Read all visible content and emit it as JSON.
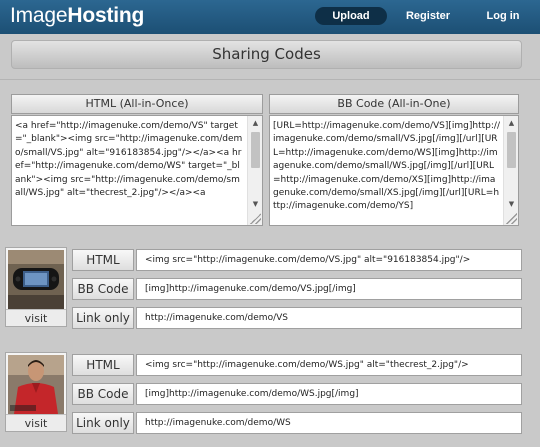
{
  "header": {
    "logo_light": "Image",
    "logo_bold": "Hosting",
    "nav": {
      "upload": "Upload",
      "register": "Register",
      "login": "Log in"
    }
  },
  "page_title": "Sharing Codes",
  "panels": {
    "html": {
      "title": "HTML (All-in-Once)",
      "text": "<a href=\"http://imagenuke.com/demo/VS\" target=\"_blank\"><img src=\"http://imagenuke.com/demo/small/VS.jpg\" alt=\"916183854.jpg\"/></a><a href=\"http://imagenuke.com/demo/WS\" target=\"_blank\"><img src=\"http://imagenuke.com/demo/small/WS.jpg\" alt=\"thecrest_2.jpg\"/></a><a"
    },
    "bbcode": {
      "title": "BB Code (All-in-One)",
      "text": "[URL=http://imagenuke.com/demo/VS][img]http://imagenuke.com/demo/small/VS.jpg[/img][/url][URL=http://imagenuke.com/demo/WS][img]http://imagenuke.com/demo/small/WS.jpg[/img][/url][URL=http://imagenuke.com/demo/XS][img]http://imagenuke.com/demo/small/XS.jpg[/img][/url][URL=http://imagenuke.com/demo/YS]"
    }
  },
  "labels": {
    "html": "HTML",
    "bbcode": "BB Code",
    "link": "Link only",
    "visit": "visit"
  },
  "images": [
    {
      "html": "<img src=\"http://imagenuke.com/demo/VS.jpg\" alt=\"916183854.jpg\"/>",
      "bbcode": "[img]http://imagenuke.com/demo/VS.jpg[/img]",
      "link": "http://imagenuke.com/demo/VS"
    },
    {
      "html": "<img src=\"http://imagenuke.com/demo/WS.jpg\" alt=\"thecrest_2.jpg\"/>",
      "bbcode": "[img]http://imagenuke.com/demo/WS.jpg[/img]",
      "link": "http://imagenuke.com/demo/WS"
    }
  ],
  "colors": {
    "header": "#1f557c",
    "upload_pill": "#0e2f47",
    "background": "#c9c9c9"
  }
}
